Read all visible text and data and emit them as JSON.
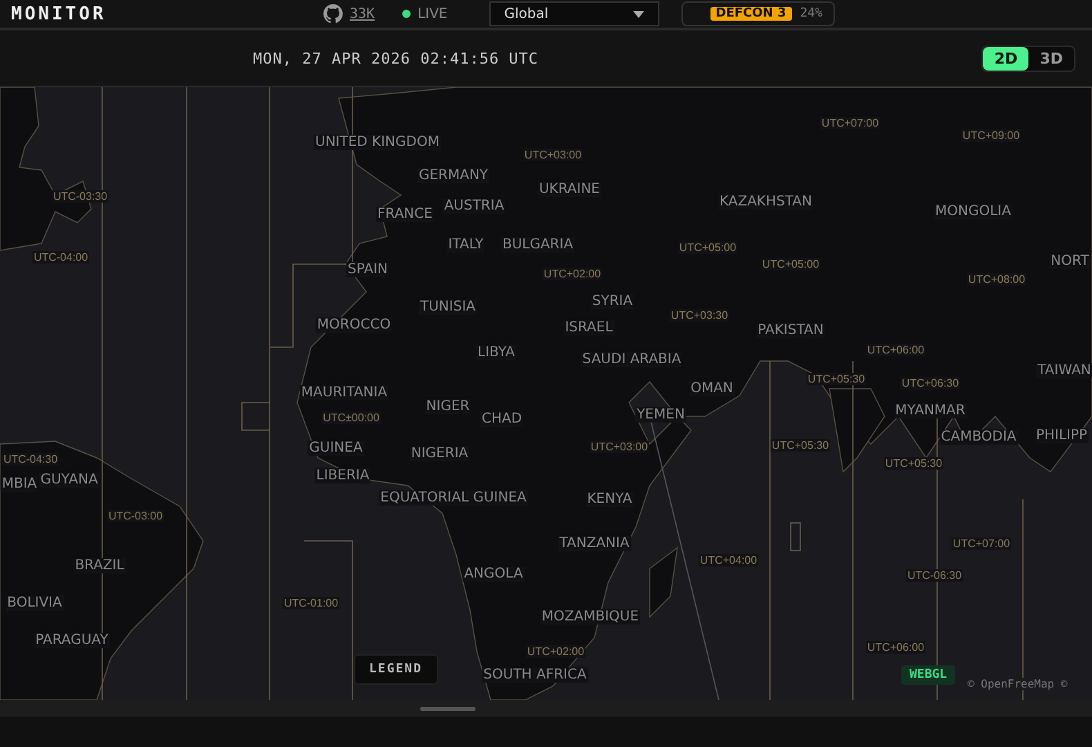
{
  "header": {
    "brand": "MONITOR",
    "stars": "33K",
    "live": "LIVE",
    "region_select": "Global",
    "defcon": {
      "badge": "DEFCON 3",
      "percent": "24%"
    }
  },
  "toolbar": {
    "datetime": "MON, 27 APR 2026 02:41:56 UTC",
    "view_modes": [
      {
        "label": "2D",
        "selected": true
      },
      {
        "label": "3D",
        "selected": false
      }
    ]
  },
  "map": {
    "country_labels": [
      "UNITED KINGDOM",
      "GERMANY",
      "UKRAINE",
      "FRANCE",
      "AUSTRIA",
      "KAZAKHSTAN",
      "MONGOLIA",
      "ITALY",
      "BULGARIA",
      "NORT",
      "SPAIN",
      "SYRIA",
      "TUNISIA",
      "MOROCCO",
      "ISRAEL",
      "PAKISTAN",
      "LIBYA",
      "SAUDI ARABIA",
      "TAIWAN",
      "OMAN",
      "MAURITANIA",
      "NIGER",
      "MYANMAR",
      "YEMEN",
      "CHAD",
      "CAMBODIA",
      "PHILIPP",
      "GUINEA",
      "NIGERIA",
      "LIBERIA",
      "MBIA",
      "GUYANA",
      "EQUATORIAL GUINEA",
      "KENYA",
      "TANZANIA",
      "BRAZIL",
      "ANGOLA",
      "BOLIVIA",
      "MOZAMBIQUE",
      "PARAGUAY",
      "SOUTH AFRICA"
    ],
    "timezone_labels": [
      "UTC+07:00",
      "UTC+09:00",
      "UTC+03:00",
      "UTC-03:30",
      "UTC+05:00",
      "UTC-04:00",
      "UTC+05:00",
      "UTC+02:00",
      "UTC+08:00",
      "UTC+03:30",
      "UTC+06:00",
      "UTC+05:30",
      "UTC+06:30",
      "UTC±00:00",
      "UTC+05:30",
      "UTC+03:00",
      "UTC-04:30",
      "UTC+05:30",
      "UTC-03:00",
      "UTC+07:00",
      "UTC+04:00",
      "UTC-06:30",
      "UTC-01:00",
      "UTC+06:00",
      "UTC+02:00"
    ],
    "legend_button": "LEGEND",
    "renderer_badge": "WEBGL",
    "attribution": "© OpenFreeMap ©"
  }
}
